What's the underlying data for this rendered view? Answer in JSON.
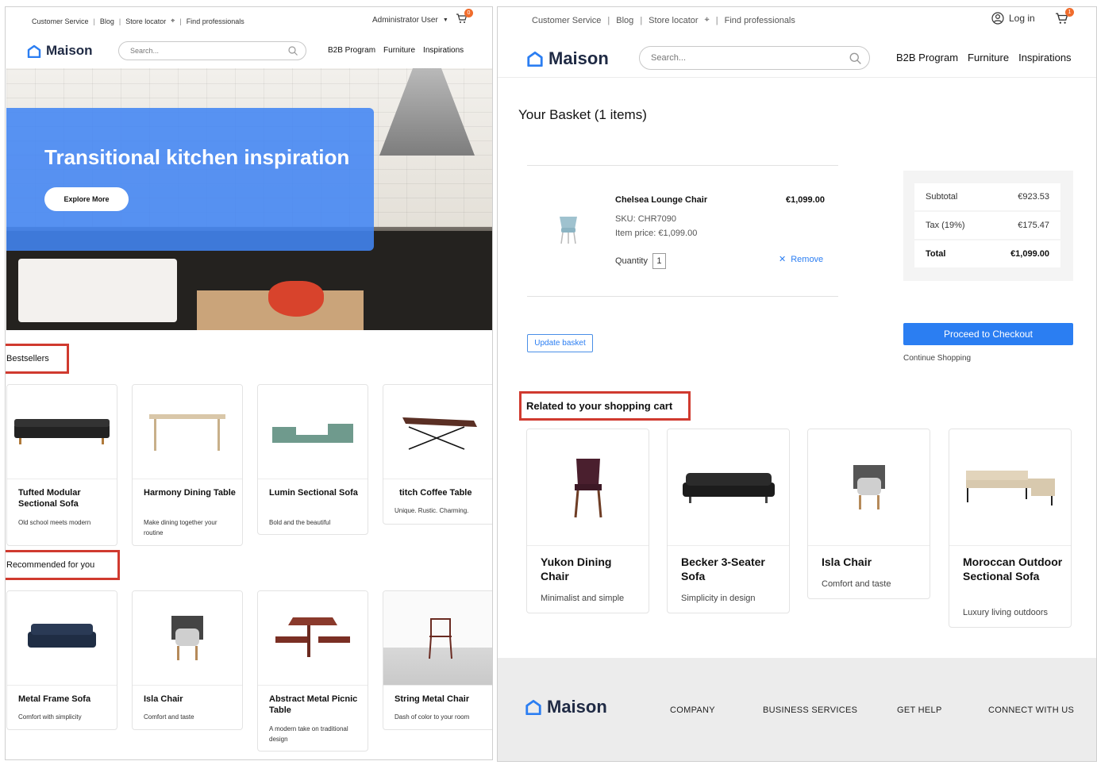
{
  "brand": {
    "name": "Maison",
    "accent": "#2b7ef2",
    "highlight": "#d03a2f"
  },
  "left": {
    "util_links": [
      "Customer Service",
      "Blog",
      "Store locator",
      "Find professionals"
    ],
    "user_menu": "Administrator User",
    "cart_count": "0",
    "search_placeholder": "Search...",
    "nav": [
      "B2B Program",
      "Furniture",
      "Inspirations"
    ],
    "hero": {
      "title": "Transitional kitchen inspiration",
      "button": "Explore More"
    },
    "bestsellers": {
      "heading": "Bestsellers",
      "items": [
        {
          "title": "Tufted Modular Sectional Sofa",
          "desc": "Old school meets modern"
        },
        {
          "title": "Harmony Dining Table",
          "desc": "Make dining together your routine"
        },
        {
          "title": "Lumin Sectional Sofa",
          "desc": "Bold and the beautiful"
        },
        {
          "title": "titch Coffee Table",
          "desc": "Unique. Rustic. Charming."
        }
      ]
    },
    "recommended": {
      "heading": "Recommended for you",
      "items": [
        {
          "title": "Metal Frame Sofa",
          "desc": "Comfort with simplicity"
        },
        {
          "title": "Isla Chair",
          "desc": "Comfort and taste"
        },
        {
          "title": "Abstract Metal Picnic Table",
          "desc": "A modern take on traditional design"
        },
        {
          "title": "String Metal Chair",
          "desc": "Dash of color to your room"
        }
      ]
    }
  },
  "right": {
    "util_links": [
      "Customer Service",
      "Blog",
      "Store locator",
      "Find professionals"
    ],
    "login": "Log in",
    "cart_count": "1",
    "search_placeholder": "Search...",
    "nav": [
      "B2B Program",
      "Furniture",
      "Inspirations"
    ],
    "basket": {
      "title": "Your Basket (1 items)",
      "item": {
        "name": "Chelsea Lounge Chair",
        "price": "€1,099.00",
        "sku": "SKU: CHR7090",
        "item_price": "Item price: €1,099.00",
        "quantity_label": "Quantity",
        "quantity": "1",
        "remove": "Remove"
      },
      "update": "Update basket",
      "summary": [
        {
          "label": "Subtotal",
          "value": "€923.53"
        },
        {
          "label": "Tax (19%)",
          "value": "€175.47"
        },
        {
          "label": "Total",
          "value": "€1,099.00"
        }
      ],
      "checkout": "Proceed to Checkout",
      "continue": "Continue Shopping"
    },
    "related": {
      "heading": "Related to your shopping cart",
      "items": [
        {
          "title": "Yukon Dining Chair",
          "desc": "Minimalist and simple"
        },
        {
          "title": "Becker 3-Seater Sofa",
          "desc": "Simplicity in design"
        },
        {
          "title": "Isla Chair",
          "desc": "Comfort and taste"
        },
        {
          "title": "Moroccan Outdoor Sectional Sofa",
          "desc": "Luxury living outdoors"
        }
      ]
    },
    "footer": [
      "COMPANY",
      "BUSINESS SERVICES",
      "GET HELP",
      "CONNECT WITH US"
    ]
  }
}
